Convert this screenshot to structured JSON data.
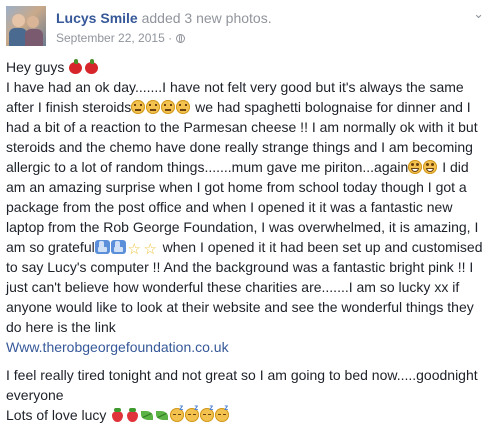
{
  "post": {
    "author": "Lucys Smile",
    "action": "added 3 new photos.",
    "date": "September 22, 2015",
    "separator": "·",
    "menu_glyph": "⌄",
    "privacy_icon": "globe-icon",
    "menu_icon": "chevron-down-icon"
  },
  "body": {
    "greeting": "Hey guys",
    "p1_a": "I have had an ok day.......I have not felt very good but it's always the same after I finish steroids",
    "p1_b": " we had spaghetti bolognaise for dinner and I had a bit of a reaction to the Parmesan cheese !! I am normally ok with it but steroids and the chemo have done really strange things and I am becoming allergic to a lot of random things.......mum gave me piriton...again",
    "p1_c": " I did am an amazing surprise when I got home from school today though I got a package from the post office and when I opened it it was a fantastic new laptop from the Rob George Foundation, I was overwhelmed, it is amazing, I am so grateful",
    "p1_d": " when I opened it it had been set up and customised to say Lucy's computer !! And the background was a fantastic bright pink !! I just can't believe how wonderful these charities are.......I am so lucky xx if anyone would like to look at their website and see the wonderful things they do here is the link",
    "link": "Www.therobgeorgefoundation.co.uk",
    "p2_a": "I feel really tired tonight and not great so I am going to bed now.....goodnight everyone",
    "p2_b": "Lots of love lucy",
    "emoji": {
      "greeting": [
        "apple",
        "apple"
      ],
      "after_steroids": [
        "disappointed-face",
        "disappointed-face",
        "disappointed-face",
        "disappointed-face"
      ],
      "after_piriton": [
        "grinning-face",
        "grinning-face"
      ],
      "after_grateful": [
        "thumbs-up",
        "thumbs-up",
        "star",
        "star"
      ],
      "signoff": [
        "strawberry",
        "strawberry",
        "leaf",
        "leaf",
        "sleepy-face",
        "sleepy-face",
        "sleepy-face",
        "sleepy-face"
      ]
    },
    "star_glyph": "☆"
  }
}
